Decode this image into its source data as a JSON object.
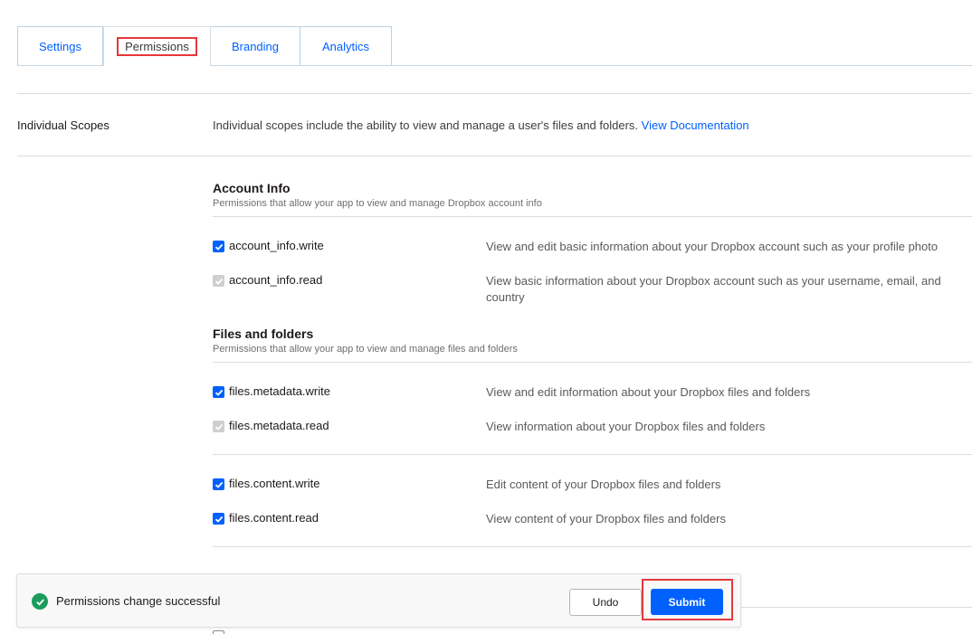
{
  "tabs": [
    "Settings",
    "Permissions",
    "Branding",
    "Analytics"
  ],
  "active_tab": "Permissions",
  "individual_scopes": {
    "label": "Individual Scopes",
    "description": "Individual scopes include the ability to view and manage a user's files and folders.",
    "link": "View Documentation"
  },
  "sections": {
    "account_info": {
      "title": "Account Info",
      "subtitle": "Permissions that allow your app to view and manage Dropbox account info",
      "perms": [
        {
          "name": "account_info.write",
          "state": "checked",
          "description": "View and edit basic information about your Dropbox account such as your profile photo"
        },
        {
          "name": "account_info.read",
          "state": "disabled-checked",
          "description": "View basic information about your Dropbox account such as your username, email, and country"
        }
      ]
    },
    "files": {
      "title": "Files and folders",
      "subtitle": "Permissions that allow your app to view and manage files and folders",
      "perms": [
        {
          "name": "files.metadata.write",
          "state": "checked",
          "description": "View and edit information about your Dropbox files and folders"
        },
        {
          "name": "files.metadata.read",
          "state": "disabled-checked",
          "description": "View information about your Dropbox files and folders"
        },
        {
          "name": "files.content.write",
          "state": "checked",
          "description": "Edit content of your Dropbox files and folders"
        },
        {
          "name": "files.content.read",
          "state": "checked",
          "description": "View content of your Dropbox files and folders"
        }
      ]
    }
  },
  "toast": {
    "message": "Permissions change successful",
    "undo_label": "Undo",
    "submit_label": "Submit"
  },
  "colors": {
    "accent": "#0061fe",
    "success": "#1a9c5a",
    "highlight": "#e5383b"
  }
}
